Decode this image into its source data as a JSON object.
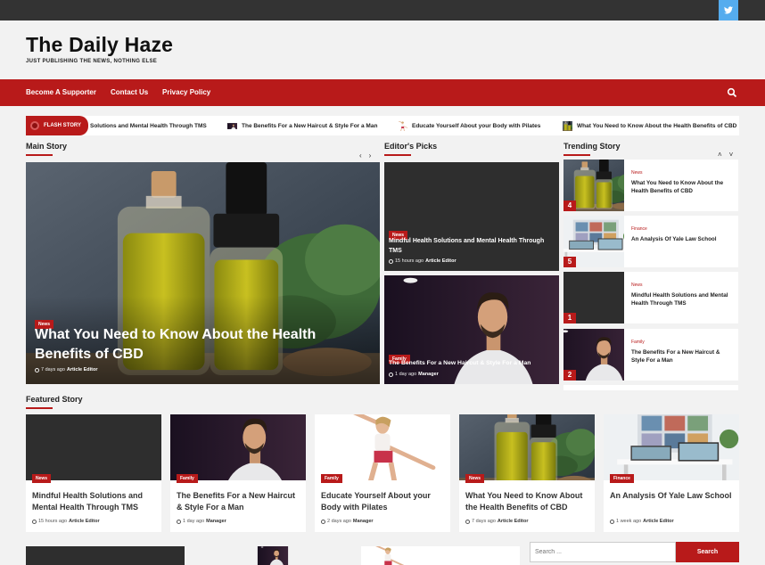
{
  "site": {
    "title": "The Daily Haze",
    "tagline": "JUST PUBLISHING THE NEWS, NOTHING ELSE"
  },
  "colors": {
    "accent": "#b81a1a",
    "topbar": "#333333",
    "twitter": "#55acee"
  },
  "nav": {
    "items": [
      "Become A Supporter",
      "Contact Us",
      "Privacy Policy"
    ],
    "search_icon": "search-icon"
  },
  "ticker": {
    "label": "FLASH STORY",
    "items": [
      "Solutions and Mental Health Through TMS",
      "The Benefits For a New Haircut & Style For a Man",
      "Educate Yourself About your Body with Pilates",
      "What You Need to Know About the Health Benefits of CBD"
    ]
  },
  "main_story": {
    "heading": "Main Story",
    "category": "News",
    "title": "What You Need to Know About the Health Benefits of CBD",
    "time": "7 days ago",
    "author": "Article Editor"
  },
  "editors_picks": {
    "heading": "Editor's Picks",
    "items": [
      {
        "category": "News",
        "title": "Mindful Health Solutions and Mental Health Through TMS",
        "time": "15 hours ago",
        "author": "Article Editor"
      },
      {
        "category": "Family",
        "title": "The Benefits For a New Haircut & Style For a Man",
        "time": "1 day ago",
        "author": "Manager"
      }
    ]
  },
  "trending": {
    "heading": "Trending Story",
    "items": [
      {
        "rank": "4",
        "category": "News",
        "title": "What You Need to Know About the Health Benefits of CBD"
      },
      {
        "rank": "5",
        "category": "Finance",
        "title": "An Analysis Of Yale Law School"
      },
      {
        "rank": "1",
        "category": "News",
        "title": "Mindful Health Solutions and Mental Health Through TMS"
      },
      {
        "rank": "2",
        "category": "Family",
        "title": "The Benefits For a New Haircut & Style For a Man"
      }
    ]
  },
  "featured": {
    "heading": "Featured Story",
    "items": [
      {
        "category": "News",
        "title": "Mindful Health Solutions and Mental Health Through TMS",
        "time": "15 hours ago",
        "author": "Article Editor"
      },
      {
        "category": "Family",
        "title": "The Benefits For a New Haircut & Style For a Man",
        "time": "1 day ago",
        "author": "Manager"
      },
      {
        "category": "Family",
        "title": "Educate Yourself About your Body with Pilates",
        "time": "2 days ago",
        "author": "Manager"
      },
      {
        "category": "News",
        "title": "What You Need to Know About the Health Benefits of CBD",
        "time": "7 days ago",
        "author": "Article Editor"
      },
      {
        "category": "Finance",
        "title": "An Analysis Of Yale Law School",
        "time": "1 week ago",
        "author": "Article Editor"
      }
    ]
  },
  "search": {
    "placeholder": "Search ...",
    "button": "Search"
  }
}
